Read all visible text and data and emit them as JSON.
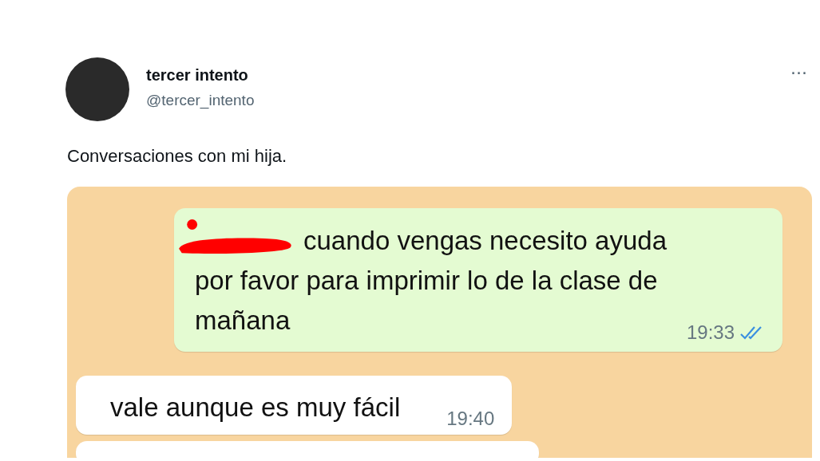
{
  "tweet": {
    "author_name": "tercer intento",
    "handle": "@tercer_intento",
    "more": "···",
    "text": "Conversaciones con mi hija."
  },
  "chat": {
    "messages": [
      {
        "kind": "outgoing",
        "redacted": true,
        "text": "cuando vengas necesito ayuda por favor para imprimir lo de la clase de mañana",
        "time": "19:33",
        "read": true
      },
      {
        "kind": "incoming",
        "text": "vale aunque es muy fácil",
        "time": "19:40"
      }
    ]
  }
}
